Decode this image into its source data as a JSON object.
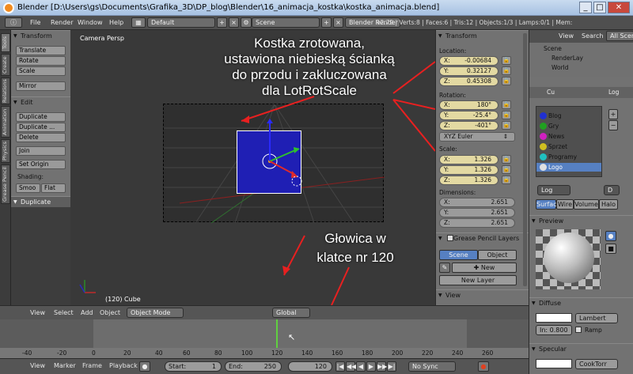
{
  "window": {
    "title": "Blender [D:\\Users\\gs\\Documents\\Grafika_3D\\DP_blog\\Blender\\16_animacja_kostka\\kostka_animacja.blend]",
    "min": "_",
    "max": "□",
    "close": "✕"
  },
  "infobar": {
    "menus": [
      "File",
      "Render",
      "Window",
      "Help"
    ],
    "screen_layout": "Default",
    "scene": "Scene",
    "engine": "Blender Render",
    "stats": "v2.79 | Verts:8 | Faces:6 | Tris:12 | Objects:1/3 | Lamps:0/1 | Mem:"
  },
  "tool_tabs": [
    "Tools",
    "Create",
    "Relations",
    "Animation",
    "Physics",
    "Grease Pencil"
  ],
  "tool_shelf": {
    "transform_header": "Transform",
    "transform_buttons": [
      "Translate",
      "Rotate",
      "Scale"
    ],
    "mirror": "Mirror",
    "edit_header": "Edit",
    "edit_buttons": [
      "Duplicate",
      "Duplicate ...",
      "Delete"
    ],
    "join": "Join",
    "set_origin": "Set Origin",
    "shading_label": "Shading:",
    "shading_smooth": "Smoo",
    "shading_flat": "Flat",
    "duplicate_header": "Duplicate"
  },
  "viewport": {
    "camera_label": "Camera Persp",
    "object_label": "(120) Cube"
  },
  "properties": {
    "transform_header": "Transform",
    "location_label": "Location:",
    "location": [
      {
        "axis": "X:",
        "value": "-0.00684"
      },
      {
        "axis": "Y:",
        "value": "0.32127"
      },
      {
        "axis": "Z:",
        "value": "0.45308"
      }
    ],
    "rotation_label": "Rotation:",
    "rotation": [
      {
        "axis": "X:",
        "value": "180°"
      },
      {
        "axis": "Y:",
        "value": "-25.4°"
      },
      {
        "axis": "Z:",
        "value": "-401°"
      }
    ],
    "rotation_mode": "XYZ Euler",
    "scale_label": "Scale:",
    "scale": [
      {
        "axis": "X:",
        "value": "1.326"
      },
      {
        "axis": "Y:",
        "value": "1.326"
      },
      {
        "axis": "Z:",
        "value": "1.326"
      }
    ],
    "dimensions_label": "Dimensions:",
    "dimensions": [
      {
        "axis": "X:",
        "value": "2.651"
      },
      {
        "axis": "Y:",
        "value": "2.651"
      },
      {
        "axis": "Z:",
        "value": "2.651"
      }
    ],
    "grease_header": "Grease Pencil Layers",
    "grease_tabs": [
      "Scene",
      "Object"
    ],
    "new_btn": "New",
    "new_layer_btn": "New Layer",
    "view_header": "View"
  },
  "outliner": {
    "menus": [
      "View",
      "Search",
      "All Scen"
    ],
    "items": [
      "Scene",
      "RenderLay",
      "World"
    ]
  },
  "material_panel": {
    "breadcrumb": [
      "Cu",
      "Log"
    ],
    "slots": [
      {
        "name": "Blog",
        "color": "#2030d0"
      },
      {
        "name": "Gry",
        "color": "#20a020"
      },
      {
        "name": "News",
        "color": "#d020c0"
      },
      {
        "name": "Sprzet",
        "color": "#d0c020"
      },
      {
        "name": "Programy",
        "color": "#20c0c0"
      },
      {
        "name": "Logo",
        "color": "#e0e0e0"
      }
    ],
    "material_name": "Log",
    "data_btn": "D",
    "preview_tabs": [
      "Surface",
      "Wire",
      "Volume",
      "Halo"
    ],
    "preview_header": "Preview",
    "diffuse_header": "Diffuse",
    "diffuse_shader": "Lambert",
    "intensity": "In: 0.800",
    "ramp": "Ramp",
    "specular_header": "Specular",
    "specular_shader": "CookTorr"
  },
  "tl_header": {
    "menus": [
      "View",
      "Select",
      "Add",
      "Object"
    ],
    "mode": "Object Mode",
    "orientation": "Global"
  },
  "timeline": {
    "ticks": [
      "-40",
      "-20",
      "0",
      "20",
      "40",
      "60",
      "80",
      "100",
      "120",
      "140",
      "160",
      "180",
      "200",
      "220",
      "240",
      "260"
    ],
    "current_frame": 120
  },
  "tl_bottom": {
    "menus": [
      "View",
      "Marker",
      "Frame",
      "Playback"
    ],
    "start_label": "Start:",
    "start": "1",
    "end_label": "End:",
    "end": "250",
    "current": "120",
    "sync": "No Sync"
  },
  "annotations": {
    "top": [
      "Kostka zrotowana,",
      "ustawiona niebieską ścianką",
      "do przodu i zakluczowana",
      "dla LotRotScale"
    ],
    "bottom": [
      "Głowica w",
      "klatce nr 120"
    ]
  },
  "colors": {
    "cube": "#1f1fb4",
    "field_yellow": "#e3d9a2",
    "active_blue": "#5680c2"
  }
}
